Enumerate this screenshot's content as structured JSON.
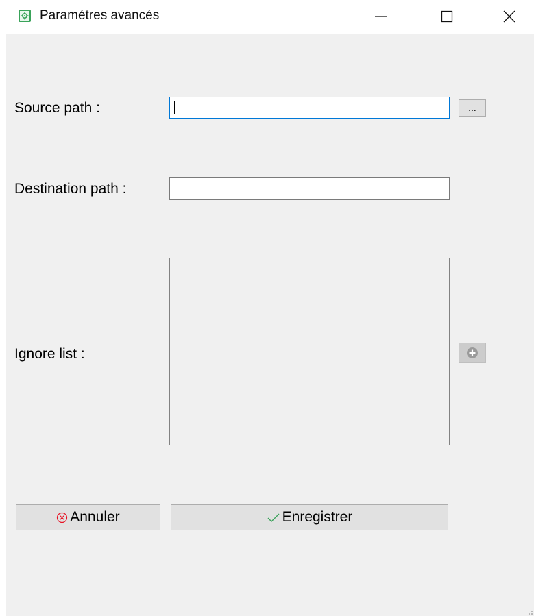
{
  "window": {
    "title": "Paramétres avancés",
    "icon": "gear-icon",
    "controls": [
      "minimize-icon",
      "maximize-icon",
      "close-icon"
    ]
  },
  "form": {
    "source_path": {
      "label": "Source path :",
      "value": "",
      "browse_label": "..."
    },
    "destination_path": {
      "label": "Destination path :",
      "value": ""
    },
    "ignore_list": {
      "label": "Ignore list :",
      "items": [],
      "add_icon": "plus-circle-icon"
    }
  },
  "buttons": {
    "cancel": {
      "label": "Annuler",
      "icon": "cancel-circle-icon",
      "icon_color": "#e81123"
    },
    "save": {
      "label": "Enregistrer",
      "icon": "checkmark-icon",
      "icon_color": "#3aa35a"
    }
  },
  "colors": {
    "focus_border": "#0078d7",
    "client_bg": "#f0f0f0",
    "button_bg": "#e1e1e1"
  }
}
